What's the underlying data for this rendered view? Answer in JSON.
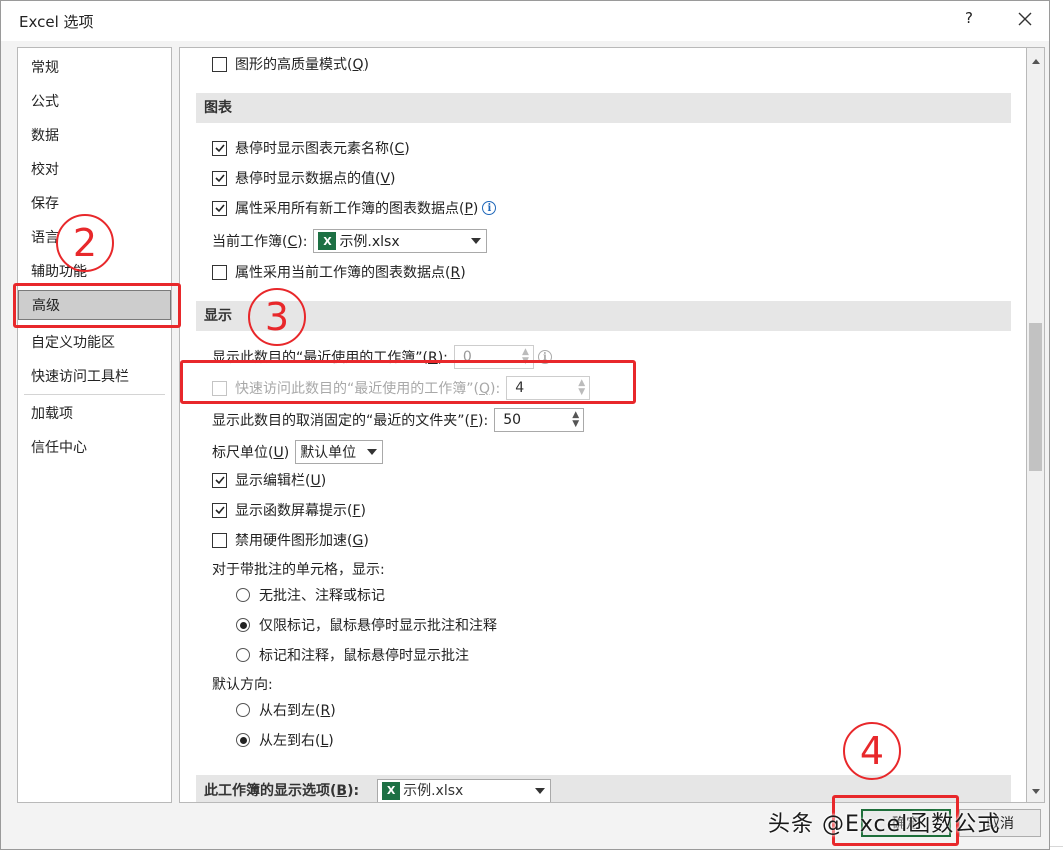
{
  "dialog": {
    "title": "Excel 选项",
    "help_label": "?"
  },
  "sidebar": {
    "items": [
      {
        "label": "常规"
      },
      {
        "label": "公式"
      },
      {
        "label": "数据"
      },
      {
        "label": "校对"
      },
      {
        "label": "保存"
      },
      {
        "label": "语言"
      },
      {
        "label": "辅助功能"
      },
      {
        "label": "高级",
        "selected": true
      },
      {
        "label": "自定义功能区"
      },
      {
        "label": "快速访问工具栏"
      },
      {
        "label": "加载项"
      },
      {
        "label": "信任中心"
      }
    ]
  },
  "content": {
    "top_option": {
      "label": "图形的高质量模式(",
      "key": "Q",
      "suffix": ")",
      "checked": false
    },
    "chart_section": {
      "title": "图表",
      "options": [
        {
          "pre": "悬停时显示图表元素名称(",
          "key": "C",
          "suffix": ")",
          "checked": true
        },
        {
          "pre": "悬停时显示数据点的值(",
          "key": "V",
          "suffix": ")",
          "checked": true
        },
        {
          "pre": "属性采用所有新工作簿的图表数据点(",
          "key": "P",
          "suffix": ")",
          "checked": true
        }
      ],
      "workbook_label_pre": "当前工作簿(",
      "workbook_label_key": "C",
      "workbook_label_suffix": "):",
      "workbook_value": "示例.xlsx",
      "current_option": {
        "pre": "属性采用当前工作簿的图表数据点(",
        "key": "R",
        "suffix": ")",
        "checked": false
      }
    },
    "display_section": {
      "title": "显示",
      "recent_workbooks": {
        "pre": "显示此数目的“最近使用的工作簿”(",
        "key": "R",
        "suffix": "):",
        "value": "0"
      },
      "quick_access": {
        "pre": "快速访问此数目的“最近使用的工作簿”(",
        "key": "Q",
        "suffix": "):",
        "value": "4",
        "checked": false
      },
      "unpinned_folders": {
        "pre": "显示此数目的取消固定的“最近的文件夹”(",
        "key": "F",
        "suffix": "):",
        "value": "50"
      },
      "ruler": {
        "pre": "标尺单位(",
        "key": "U",
        "suffix": ")",
        "value": "默认单位"
      },
      "options": [
        {
          "pre": "显示编辑栏(",
          "key": "U",
          "suffix": ")",
          "checked": true
        },
        {
          "pre": "显示函数屏幕提示(",
          "key": "F",
          "suffix": ")",
          "checked": true
        },
        {
          "pre": "禁用硬件图形加速(",
          "key": "G",
          "suffix": ")",
          "checked": false
        }
      ],
      "comments_label": "对于带批注的单元格，显示:",
      "comment_radios": [
        {
          "label": "无批注、注释或标记",
          "selected": false
        },
        {
          "label": "仅限标记，鼠标悬停时显示批注和注释",
          "selected": true
        },
        {
          "label": "标记和注释，鼠标悬停时显示批注",
          "selected": false
        }
      ],
      "direction_label": "默认方向:",
      "direction_radios": [
        {
          "pre": "从右到左(",
          "key": "R",
          "suffix": ")",
          "selected": false
        },
        {
          "pre": "从左到右(",
          "key": "L",
          "suffix": ")",
          "selected": true
        }
      ]
    },
    "workbook_display_section": {
      "title_pre": "此工作簿的显示选项(",
      "title_key": "B",
      "title_suffix": "):",
      "value": "示例.xlsx"
    }
  },
  "footer": {
    "ok_label": "确定",
    "cancel_label": "取消"
  },
  "annotations": {
    "n2": "2",
    "n3": "3",
    "n4": "4",
    "watermark": "头条 @Excel函数公式"
  },
  "colors": {
    "annotation_red": "#e8282b",
    "excel_green": "#1d7044",
    "selected_bg": "#cdcdcd"
  }
}
